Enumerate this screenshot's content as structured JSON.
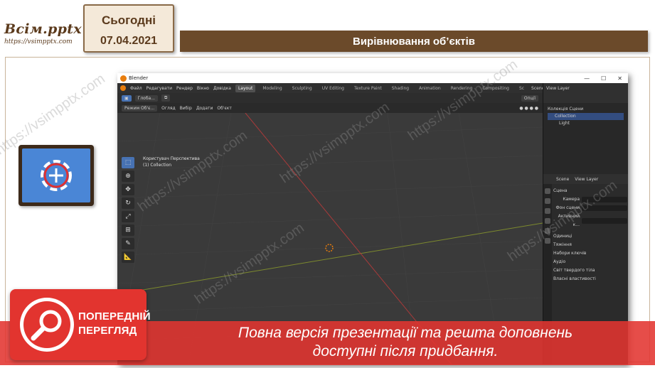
{
  "brand": {
    "title": "Всім.pptx",
    "url": "https://vsimpptx.com"
  },
  "date_box": {
    "day": "Сьогодні",
    "date": "07.04.2021"
  },
  "slide_title": "Вирівнювання об’єктів",
  "blender": {
    "window_title": "Blender",
    "menu": [
      "Файл",
      "Редагувати",
      "Рендер",
      "Вікно",
      "Довідка"
    ],
    "workspaces": [
      "Layout",
      "Modeling",
      "Sculpting",
      "UV Editing",
      "Texture Paint",
      "Shading",
      "Animation",
      "Rendering",
      "Compositing",
      "Sc"
    ],
    "active_workspace": "Layout",
    "scene_field": "Scene",
    "view_layer": "View Layer",
    "tool_header": {
      "orientation": "Глоба...",
      "options": "Опції"
    },
    "viewport_header": [
      "Режим Об'є...",
      "Огляд",
      "Вибір",
      "Додати",
      "Об'єкт"
    ],
    "viewport_info": {
      "view": "Користувач Перспектива",
      "collection": "(1) Collection"
    },
    "outliner": {
      "root": "Колекція Сцени",
      "items": [
        {
          "label": "Collection"
        },
        {
          "label": "Light"
        }
      ]
    },
    "properties": {
      "tabs": [
        "Scene",
        "View Layer"
      ],
      "section": "Сцена",
      "fields": [
        {
          "label": "Камера"
        },
        {
          "label": "Фон сцени"
        },
        {
          "label": "Активний к..."
        }
      ],
      "panels": [
        "Одиниці",
        "Тяжіння",
        "Набори ключів",
        "Аудіо",
        "Світ твердого тіла",
        "Власні властивості"
      ]
    }
  },
  "watermark": "https://vsimpptx.com",
  "preview_badge": {
    "line1": "ПОПЕРЕДНІЙ",
    "line2": "ПЕРЕГЛЯД"
  },
  "banner": {
    "line1": "Повна версія презентації та решта доповнень",
    "line2": "доступні після придбання."
  },
  "colors": {
    "accent": "#6b4a2a",
    "banner": "#e2342f",
    "blender_blue": "#4772b3"
  }
}
